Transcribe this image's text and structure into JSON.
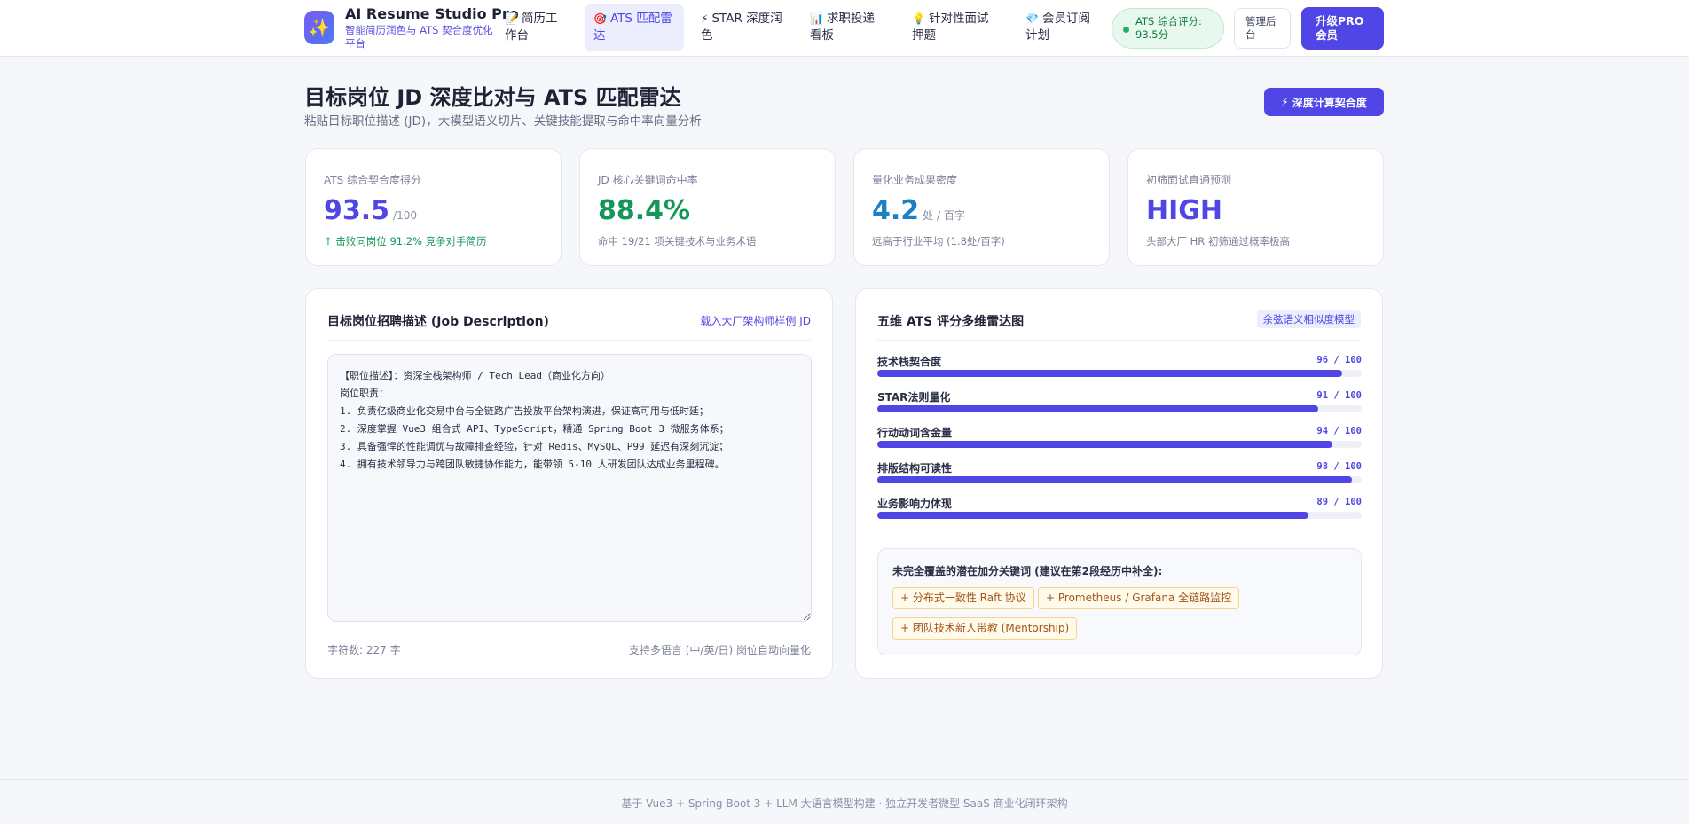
{
  "header": {
    "logo_icon": "sparkles-icon",
    "logo_glyph": "✨",
    "brand_title": "AI Resume Studio Pro",
    "brand_subtitle": "智能简历润色与 ATS 契合度优化平台",
    "nav": [
      {
        "icon": "notepad-icon",
        "glyph": "📝",
        "label": "简历工作台",
        "active": false
      },
      {
        "icon": "target-icon",
        "glyph": "🎯",
        "label": "ATS 匹配雷达",
        "active": true
      },
      {
        "icon": "lightning-icon",
        "glyph": "⚡",
        "label": "STAR 深度润色",
        "active": false
      },
      {
        "icon": "bar-chart-icon",
        "glyph": "📊",
        "label": "求职投递看板",
        "active": false
      },
      {
        "icon": "lightbulb-icon",
        "glyph": "💡",
        "label": "针对性面试押题",
        "active": false
      },
      {
        "icon": "diamond-icon",
        "glyph": "💎",
        "label": "会员订阅计划",
        "active": false
      }
    ],
    "ats_pill": "ATS 综合评分: 93.5分",
    "admin_label": "管理后台",
    "pro_label": "升级PRO会员"
  },
  "page": {
    "title": "目标岗位 JD 深度比对与 ATS 匹配雷达",
    "subtitle": "粘贴目标职位描述 (JD)，大模型语义切片、关键技能提取与命中率向量分析",
    "calc_button": "深度计算契合度",
    "calc_icon": "⚡"
  },
  "stats": [
    {
      "label": "ATS 综合契合度得分",
      "value": "93.5",
      "unit": "/100",
      "note": "↑ 击败同岗位 91.2% 竞争对手简历",
      "color": "#4f46e5",
      "note_green": true
    },
    {
      "label": "JD 核心关键词命中率",
      "value": "88.4%",
      "unit": "",
      "note": "命中 19/21 项关键技术与业务术语",
      "color": "#13985a",
      "note_green": false
    },
    {
      "label": "量化业务成果密度",
      "value": "4.2",
      "unit": "处 / 百字",
      "note": "远高于行业平均 (1.8处/百字)",
      "color": "#1d7fc4",
      "note_green": false
    },
    {
      "label": "初筛面试直通预测",
      "value": "HIGH",
      "unit": "",
      "note": "头部大厂 HR 初筛通过概率极高",
      "color": "#4f46e5",
      "note_green": false
    }
  ],
  "jd_panel": {
    "title": "目标岗位招聘描述 (Job Description)",
    "sample_link": "载入大厂架构师样例 JD",
    "jd_text": "【职位描述】：资深全栈架构师 / Tech Lead（商业化方向）\n岗位职责：\n1. 负责亿级商业化交易中台与全链路广告投放平台架构演进，保证高可用与低时延；\n2. 深度掌握 Vue3 组合式 API、TypeScript，精通 Spring Boot 3 微服务体系；\n3. 具备强悍的性能调优与故障排查经验，针对 Redis、MySQL、P99 延迟有深刻沉淀；\n4. 拥有技术领导力与跨团队敏捷协作能力，能带领 5-10 人研发团队达成业务里程碑。",
    "char_count": "字符数: 227 字",
    "hint": "支持多语言 (中/英/日) 岗位自动向量化"
  },
  "radar_panel": {
    "title": "五维 ATS 评分多维雷达图",
    "badge": "余弦语义相似度模型",
    "metrics": [
      {
        "label": "技术栈契合度",
        "score": 96,
        "score_text": "96 / 100"
      },
      {
        "label": "STAR法则量化",
        "score": 91,
        "score_text": "91 / 100"
      },
      {
        "label": "行动动词含金量",
        "score": 94,
        "score_text": "94 / 100"
      },
      {
        "label": "排版结构可读性",
        "score": 98,
        "score_text": "98 / 100"
      },
      {
        "label": "业务影响力体现",
        "score": 89,
        "score_text": "89 / 100"
      }
    ],
    "keywords_title": "未完全覆盖的潜在加分关键词 (建议在第2段经历中补全):",
    "keywords": [
      "+ 分布式一致性 Raft 协议",
      "+ Prometheus / Grafana 全链路监控",
      "+ 团队技术新人带教 (Mentorship)"
    ]
  },
  "footer": {
    "text": "基于 Vue3 + Spring Boot 3 + LLM 大语言模型构建 · 独立开发者微型 SaaS 商业化闭环架构"
  }
}
